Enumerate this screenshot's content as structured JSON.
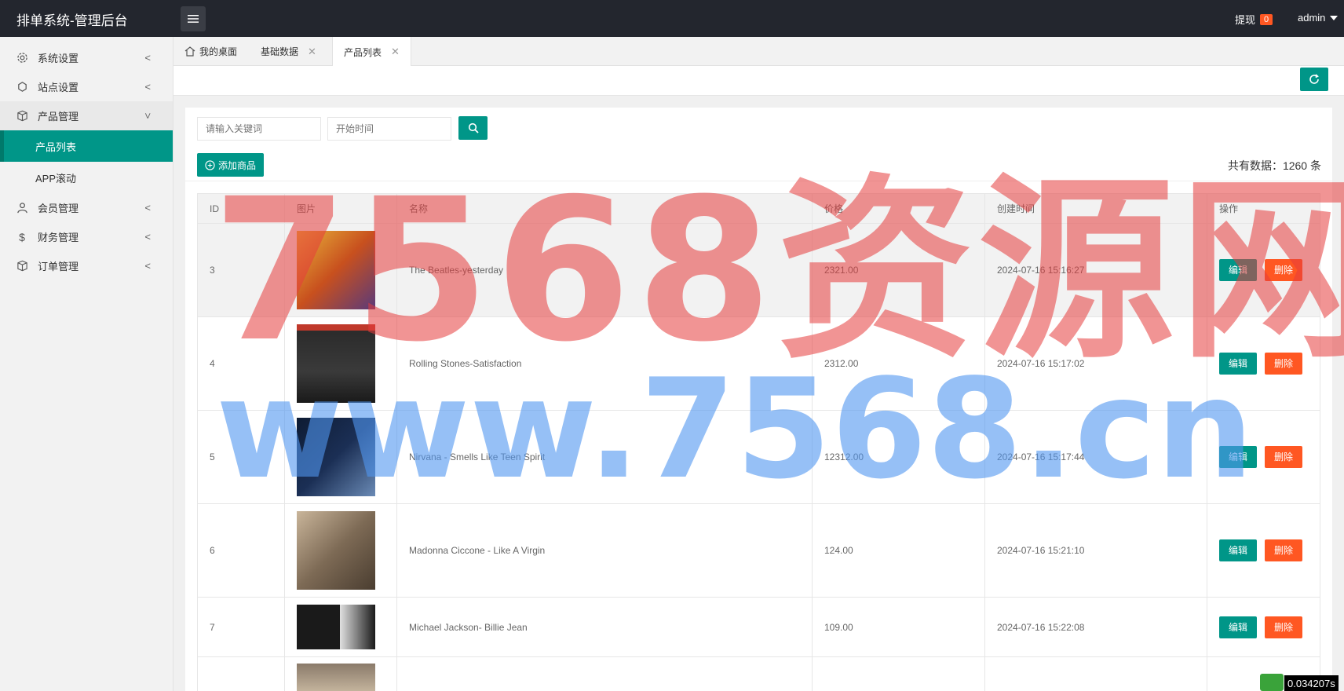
{
  "header": {
    "title": "排单系统-管理后台",
    "withdraw_label": "提现",
    "withdraw_count": "0",
    "user": "admin"
  },
  "sidebar": {
    "items": [
      {
        "label": "系统设置",
        "icon": "gear-icon"
      },
      {
        "label": "站点设置",
        "icon": "globe-icon"
      },
      {
        "label": "产品管理",
        "icon": "box-icon"
      },
      {
        "label": "会员管理",
        "icon": "user-icon"
      },
      {
        "label": "财务管理",
        "icon": "dollar-icon"
      },
      {
        "label": "订单管理",
        "icon": "box-icon"
      }
    ],
    "sub_items": [
      {
        "label": "产品列表"
      },
      {
        "label": "APP滚动"
      }
    ]
  },
  "tabs": [
    {
      "label": "我的桌面",
      "icon": "home-icon"
    },
    {
      "label": "基础数据"
    },
    {
      "label": "产品列表"
    }
  ],
  "search": {
    "keyword_placeholder": "请输入关键词",
    "date_placeholder": "开始时间"
  },
  "add_button": "添加商品",
  "total_text": "共有数据：1260 条",
  "table": {
    "headers": [
      "ID",
      "图片",
      "名称",
      "价格",
      "创建时间",
      "操作"
    ],
    "rows": [
      {
        "id": "3",
        "name": "The Beatles-yesterday",
        "price": "2321.00",
        "created": "2024-07-16 15:16:27",
        "cover_color": "#c85a1e"
      },
      {
        "id": "4",
        "name": "Rolling Stones-Satisfaction",
        "price": "2312.00",
        "created": "2024-07-16 15:17:02",
        "cover_color": "#2b2b2b"
      },
      {
        "id": "5",
        "name": "Nirvana - Smells Like Teen Spirit",
        "price": "12312.00",
        "created": "2024-07-16 15:17:44",
        "cover_color": "#1b2f55"
      },
      {
        "id": "6",
        "name": "Madonna Ciccone - Like A Virgin",
        "price": "124.00",
        "created": "2024-07-16 15:21:10",
        "cover_color": "#7d6a55"
      },
      {
        "id": "7",
        "name": "Michael Jackson- Billie Jean",
        "price": "109.00",
        "created": "2024-07-16 15:22:08",
        "cover_color": "#d8d8d8"
      }
    ],
    "edit_label": "编辑",
    "delete_label": "删除"
  },
  "watermark": {
    "line1": "7568资源网",
    "line2": "www.7568.cn"
  },
  "timer": "0.034207s",
  "colors": {
    "primary": "#009688",
    "danger": "#ff5722",
    "header_bg": "#23262e"
  }
}
